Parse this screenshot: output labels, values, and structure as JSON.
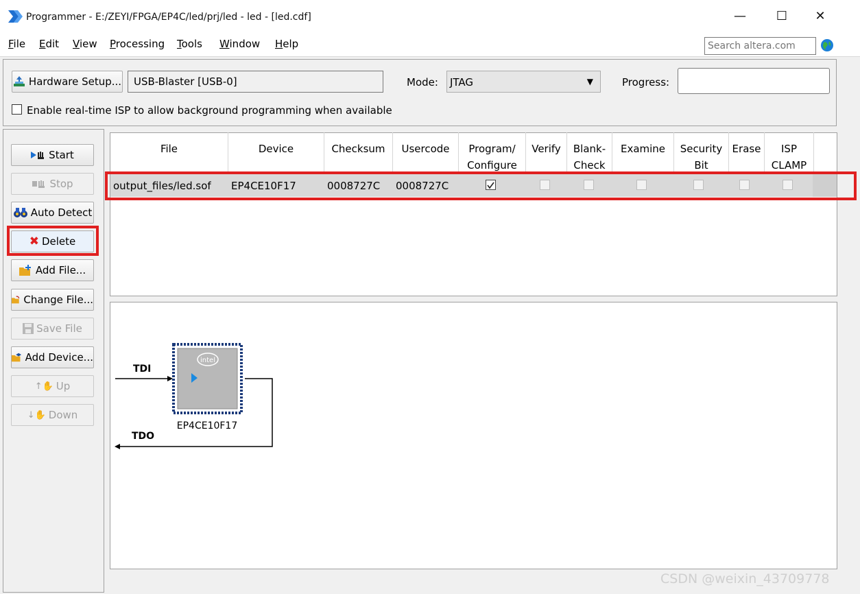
{
  "window": {
    "title": "Programmer - E:/ZEYI/FPGA/EP4C/led/prj/led - led - [led.cdf]",
    "minimize": "—",
    "maximize": "☐",
    "close": "✕"
  },
  "menu": [
    {
      "mnemonic": "F",
      "rest": "ile"
    },
    {
      "mnemonic": "E",
      "rest": "dit"
    },
    {
      "mnemonic": "V",
      "rest": "iew"
    },
    {
      "mnemonic": "P",
      "rest": "rocessing"
    },
    {
      "mnemonic": "T",
      "rest": "ools"
    },
    {
      "mnemonic": "W",
      "rest": "indow"
    },
    {
      "mnemonic": "H",
      "rest": "elp"
    }
  ],
  "search": {
    "placeholder": "Search altera.com"
  },
  "hardware": {
    "setup_label": "Hardware Setup...",
    "device": "USB-Blaster [USB-0]",
    "mode_label": "Mode:",
    "mode_value": "JTAG",
    "progress_label": "Progress:",
    "isp_label": "Enable real-time ISP to allow background programming when available",
    "isp_checked": false
  },
  "sidebar": [
    {
      "label": "Start",
      "enabled": true
    },
    {
      "label": "Stop",
      "enabled": false
    },
    {
      "label": "Auto Detect",
      "enabled": true
    },
    {
      "label": "Delete",
      "enabled": true
    },
    {
      "label": "Add File...",
      "enabled": true
    },
    {
      "label": "Change File...",
      "enabled": true
    },
    {
      "label": "Save File",
      "enabled": false
    },
    {
      "label": "Add Device...",
      "enabled": true
    },
    {
      "label": "Up",
      "enabled": false
    },
    {
      "label": "Down",
      "enabled": false
    }
  ],
  "table": {
    "headers": [
      {
        "l1": "File",
        "l2": ""
      },
      {
        "l1": "Device",
        "l2": ""
      },
      {
        "l1": "Checksum",
        "l2": ""
      },
      {
        "l1": "Usercode",
        "l2": ""
      },
      {
        "l1": "Program/",
        "l2": "Configure"
      },
      {
        "l1": "Verify",
        "l2": ""
      },
      {
        "l1": "Blank-",
        "l2": "Check"
      },
      {
        "l1": "Examine",
        "l2": ""
      },
      {
        "l1": "Security",
        "l2": "Bit"
      },
      {
        "l1": "Erase",
        "l2": ""
      },
      {
        "l1": "ISP",
        "l2": "CLAMP"
      }
    ],
    "rows": [
      {
        "file": "output_files/led.sof",
        "device": "EP4CE10F17",
        "checksum": "0008727C",
        "usercode": "0008727C",
        "checks": [
          true,
          false,
          false,
          false,
          false,
          false,
          false
        ]
      }
    ]
  },
  "chain": {
    "tdi": "TDI",
    "tdo": "TDO",
    "device_label": "EP4CE10F17",
    "chip_logo": "intel"
  },
  "watermark": "CSDN @weixin_43709778"
}
